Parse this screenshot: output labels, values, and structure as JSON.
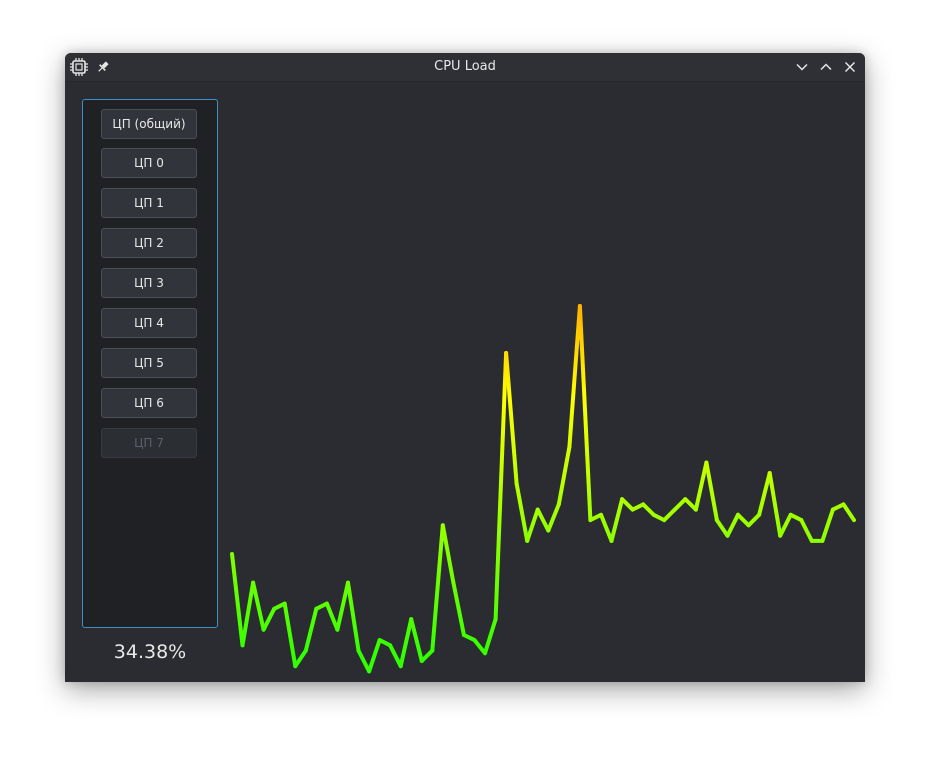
{
  "window": {
    "title": "CPU Load"
  },
  "icons": {
    "app": "cpu-chip-icon",
    "pin": "pin-icon",
    "minimize": "chevron-down-icon",
    "maximize": "chevron-up-icon",
    "close": "close-icon"
  },
  "sidebar": {
    "buttons": [
      {
        "label": "ЦП (общий)",
        "enabled": true
      },
      {
        "label": "ЦП 0",
        "enabled": true
      },
      {
        "label": "ЦП 1",
        "enabled": true
      },
      {
        "label": "ЦП 2",
        "enabled": true
      },
      {
        "label": "ЦП 3",
        "enabled": true
      },
      {
        "label": "ЦП 4",
        "enabled": true
      },
      {
        "label": "ЦП 5",
        "enabled": true
      },
      {
        "label": "ЦП 6",
        "enabled": true
      },
      {
        "label": "ЦП 7",
        "enabled": false
      }
    ],
    "current_load": "34.38%"
  },
  "colors": {
    "low": "#33ff00",
    "mid": "#ffff00",
    "high": "#ff2200",
    "accent": "#3d8fc6"
  },
  "chart_data": {
    "type": "line",
    "ylim": [
      0,
      100
    ],
    "values": [
      20.5,
      3,
      15,
      6,
      10,
      11,
      -1,
      2,
      10,
      11,
      6,
      15,
      2,
      -2,
      4,
      3,
      -1,
      8,
      0,
      2,
      26,
      15,
      5,
      4,
      1.5,
      8,
      59,
      34,
      23,
      29,
      25,
      30,
      41,
      68,
      27,
      28,
      23,
      31,
      29,
      30,
      28,
      27,
      29,
      31,
      29,
      38,
      27,
      24,
      28,
      26,
      28,
      36,
      24,
      28,
      27,
      23,
      23,
      29,
      30,
      27
    ]
  }
}
